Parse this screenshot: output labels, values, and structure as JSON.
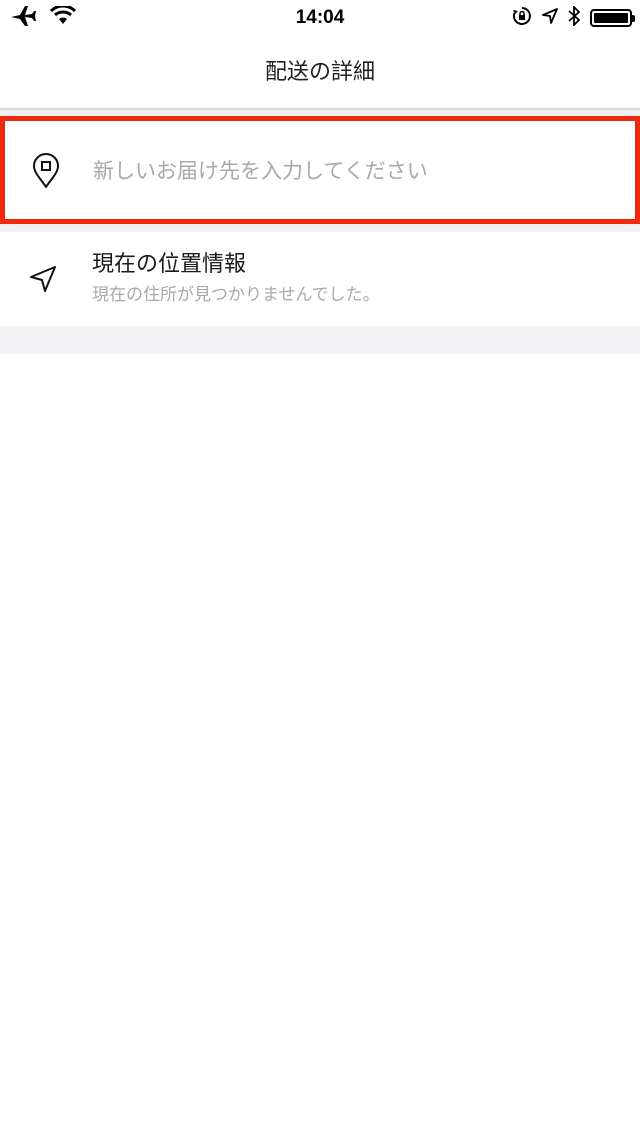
{
  "status_bar": {
    "time": "14:04",
    "left_icons": [
      "airplane-icon",
      "wifi-icon"
    ],
    "right_icons": [
      "orientation-lock-icon",
      "location-arrow-icon",
      "bluetooth-icon",
      "battery-icon"
    ],
    "battery_level": 1.0
  },
  "nav": {
    "title": "配送の詳細"
  },
  "address": {
    "icon": "map-pin-icon",
    "value": "",
    "placeholder": "新しいお届け先を入力してください",
    "highlight_color": "#f0290c"
  },
  "current_location": {
    "icon": "navigation-arrow-icon",
    "title": "現在の位置情報",
    "subtitle": "現在の住所が見つかりませんでした。"
  },
  "colors": {
    "background": "#ffffff",
    "separator_band": "#f1f1f3",
    "placeholder_text": "#a8a8ad",
    "primary_text": "#1a1a1a"
  }
}
